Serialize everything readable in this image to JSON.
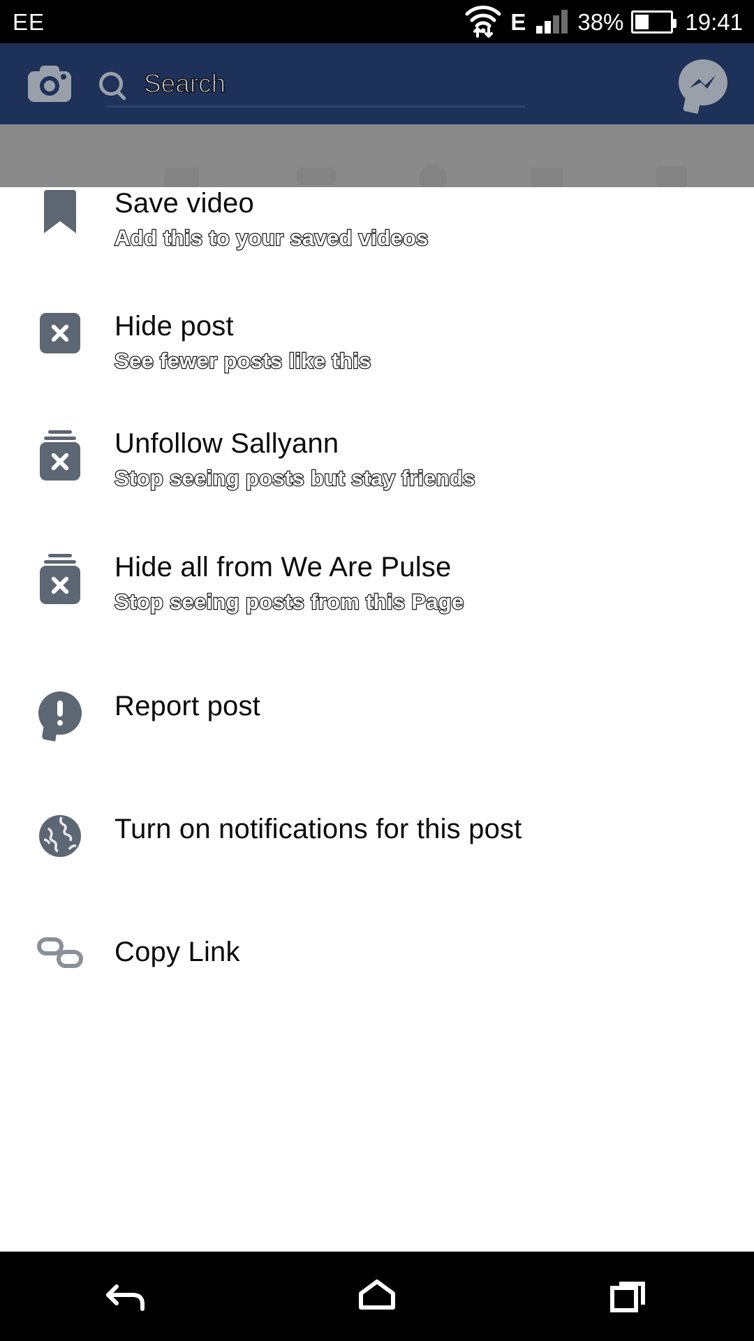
{
  "status_bar": {
    "carrier": "EE",
    "network_type": "E",
    "battery_percent": "38%",
    "time": "19:41",
    "icons": [
      "wifi-icon",
      "data-transfer-icon",
      "signal-bars-icon",
      "battery-icon"
    ]
  },
  "app_header": {
    "camera_icon": "camera-icon",
    "search": {
      "placeholder": "Search",
      "value": ""
    },
    "messenger_icon": "messenger-icon",
    "background_color": "#1d3159"
  },
  "menu": {
    "items": [
      {
        "title": "Save video",
        "subtitle": "Add this to your saved videos",
        "icon": "bookmark-icon"
      },
      {
        "title": "Hide post",
        "subtitle": "See fewer posts like this",
        "icon": "close-square-icon"
      },
      {
        "title": "Unfollow Sallyann",
        "subtitle": "Stop seeing posts but stay friends",
        "icon": "hide-stack-icon"
      },
      {
        "title": "Hide all from We Are Pulse",
        "subtitle": "Stop seeing posts from this Page",
        "icon": "hide-stack-icon"
      },
      {
        "title": "Report post",
        "subtitle": "",
        "icon": "report-icon"
      },
      {
        "title": "Turn on notifications for this post",
        "subtitle": "",
        "icon": "globe-icon"
      },
      {
        "title": "Copy Link",
        "subtitle": "",
        "icon": "link-icon"
      }
    ],
    "icon_color": "#5d6773",
    "title_color": "#0a0a0a"
  },
  "nav_bar": {
    "back": "back-icon",
    "home": "home-icon",
    "recents": "recents-icon"
  }
}
